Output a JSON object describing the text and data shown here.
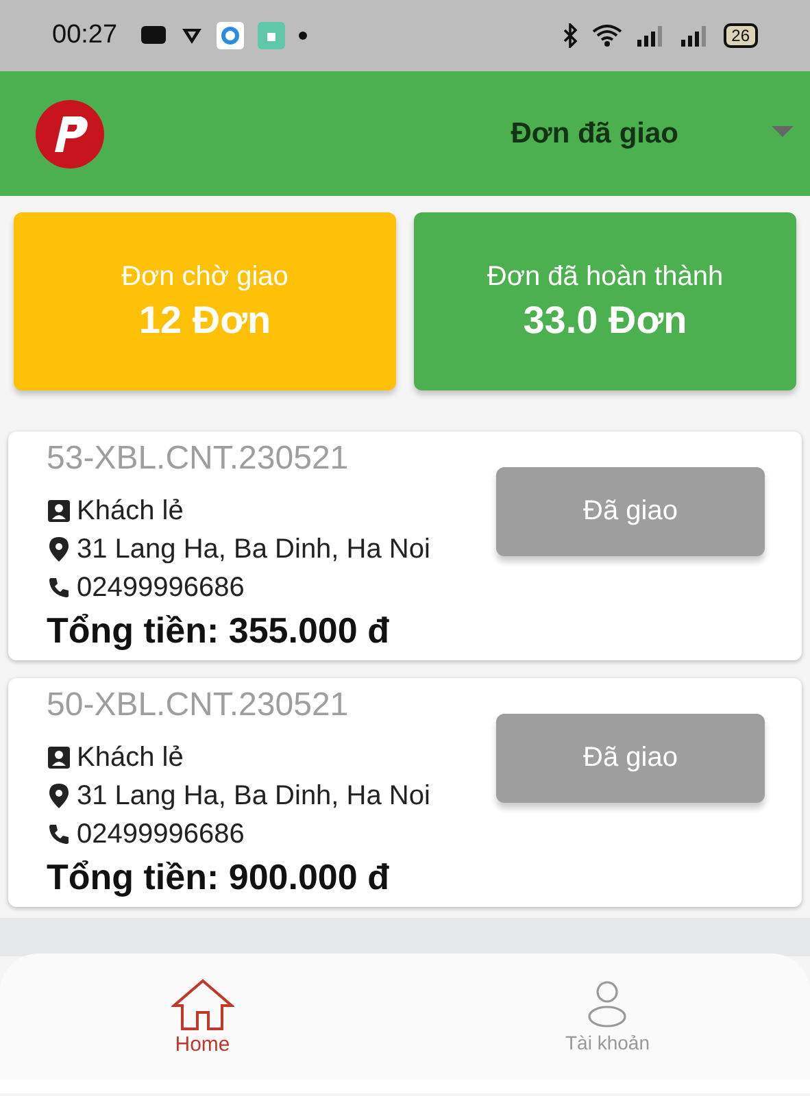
{
  "status_bar": {
    "time": "00:27",
    "battery": "26"
  },
  "header": {
    "title": "Đơn đã giao"
  },
  "stats": [
    {
      "label": "Đơn chờ giao",
      "value": "12 Đơn",
      "color": "#ffc107"
    },
    {
      "label": "Đơn đã hoàn thành",
      "value": "33.0 Đơn",
      "color": "#4caf50"
    }
  ],
  "orders": [
    {
      "code": "53-XBL.CNT.230521",
      "customer": "Khách lẻ",
      "address": "31 Lang Ha, Ba Dinh, Ha Noi",
      "phone": "02499996686",
      "total": "Tổng tiền: 355.000 đ",
      "status": "Đã giao"
    },
    {
      "code": "50-XBL.CNT.230521",
      "customer": "Khách lẻ",
      "address": "31 Lang Ha, Ba Dinh, Ha Noi",
      "phone": "02499996686",
      "total": "Tổng tiền: 900.000 đ",
      "status": "Đã giao"
    }
  ],
  "nav": [
    {
      "kind": "home",
      "label": "Home",
      "selected": true
    },
    {
      "kind": "account",
      "label": "Tài khoản",
      "selected": false
    }
  ]
}
